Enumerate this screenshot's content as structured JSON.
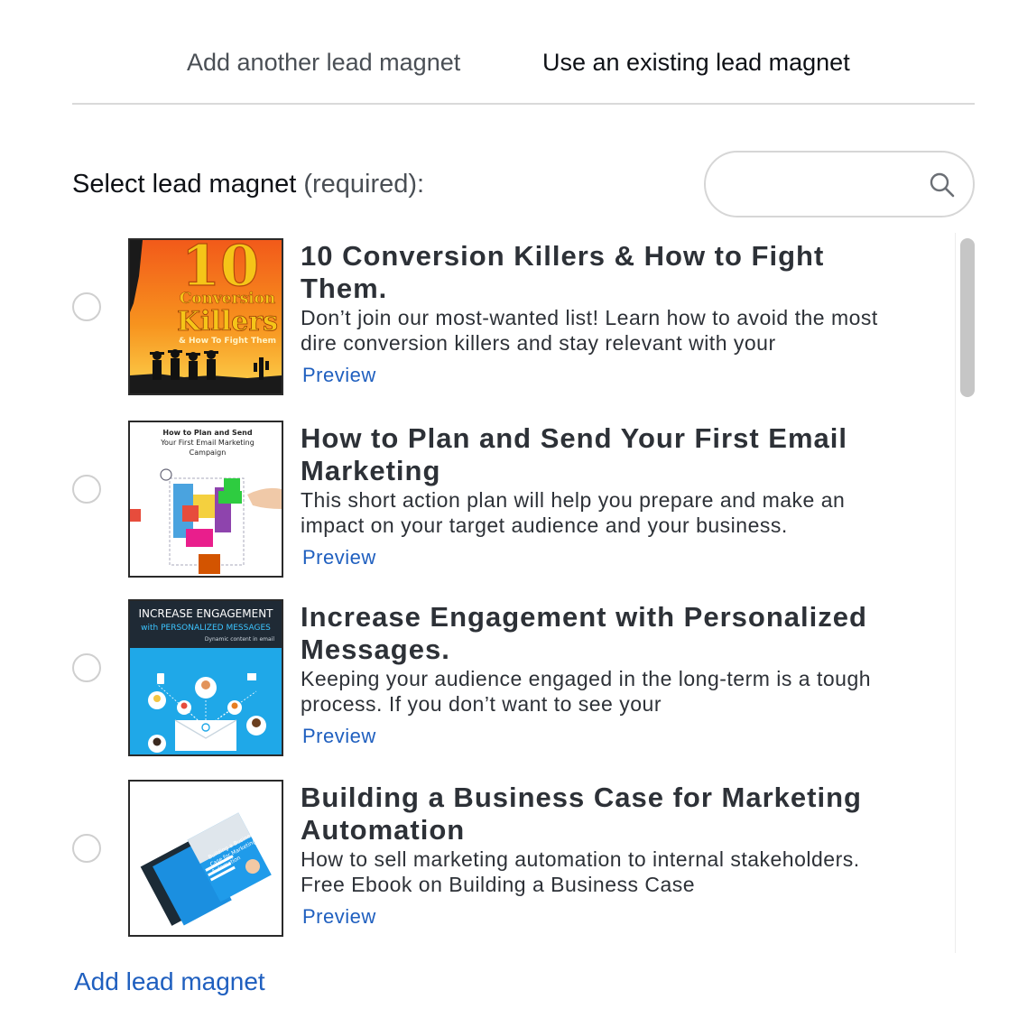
{
  "tabs": {
    "add_another": "Add another lead magnet",
    "use_existing": "Use an existing lead magnet"
  },
  "select": {
    "label": "Select lead magnet",
    "required": "(required):"
  },
  "search": {
    "placeholder": "",
    "value": "",
    "icon": "search-icon"
  },
  "items": [
    {
      "title": "10 Conversion Killers & How to Fight Them.",
      "description": "Don’t join our most-wanted list! Learn how to avoid the most dire conversion killers and stay relevant with your",
      "preview": "Preview",
      "cover": {
        "big_text": "10",
        "line1": "Conversion",
        "line2": "Killers",
        "line3": "& How To Fight Them"
      }
    },
    {
      "title": "How to Plan and Send Your First Email Marketing",
      "description": "This short action plan will help you prepare and make an impact on your target audience and your business.",
      "preview": "Preview",
      "cover": {
        "line1": "How to Plan and Send",
        "line2": "Your First Email Marketing",
        "line3": "Campaign"
      }
    },
    {
      "title": "Increase Engagement with Personalized Messages.",
      "description": "Keeping your audience engaged in the long-term is a tough process. If you don’t want to see your",
      "preview": "Preview",
      "cover": {
        "line1": "INCREASE ENGAGEMENT",
        "line2": "with PERSONALIZED MESSAGES",
        "line3": "Dynamic content in email"
      }
    },
    {
      "title": "Building a Business Case for Marketing Automation",
      "description": "How to sell marketing automation to internal stakeholders. Free Ebook on Building a Business Case",
      "preview": "Preview",
      "cover": {
        "line1": "Building a Business",
        "line2": "Case for Marketing",
        "line3": "Automation"
      }
    }
  ],
  "footer": {
    "add_link": "Add lead magnet"
  },
  "colors": {
    "link": "#1f5fbf",
    "text": "#2d3137",
    "divider": "#d9d9d9"
  }
}
